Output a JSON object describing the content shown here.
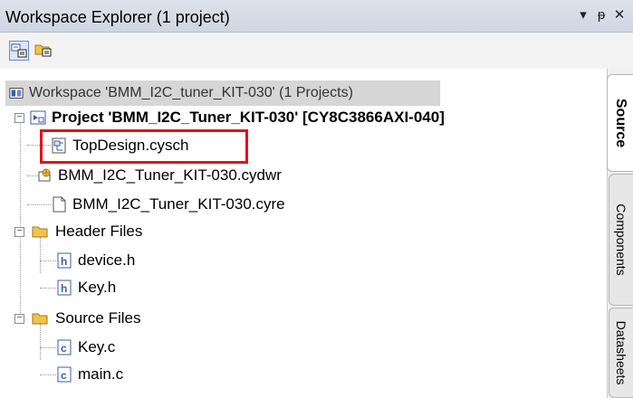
{
  "window": {
    "title": "Workspace Explorer (1 project)",
    "controls": {
      "dropdown": "▾",
      "pin": "ᵽ",
      "close": "✕"
    }
  },
  "toolbar": {
    "buttons": [
      {
        "icon": "source-view-icon"
      },
      {
        "icon": "folder-view-icon"
      }
    ]
  },
  "tree": {
    "workspace": "Workspace 'BMM_I2C_tuner_KIT-030' (1 Projects)",
    "project": "Project 'BMM_I2C_Tuner_KIT-030' [CY8C3866AXI-040]",
    "items": {
      "topdesign": "TopDesign.cysch",
      "cydwr": "BMM_I2C_Tuner_KIT-030.cydwr",
      "cyre": "BMM_I2C_Tuner_KIT-030.cyre",
      "header_folder": "Header Files",
      "device_h": "device.h",
      "key_h": "Key.h",
      "source_folder": "Source Files",
      "key_c": "Key.c",
      "main_c": "main.c"
    },
    "expander_open": "−"
  },
  "tabs": {
    "source": "Source",
    "components": "Components",
    "datasheets": "Datasheets"
  },
  "colors": {
    "highlight_box": "#e2131a",
    "folder": "#f2c34c",
    "selection_gray": "#d6d6d6"
  }
}
